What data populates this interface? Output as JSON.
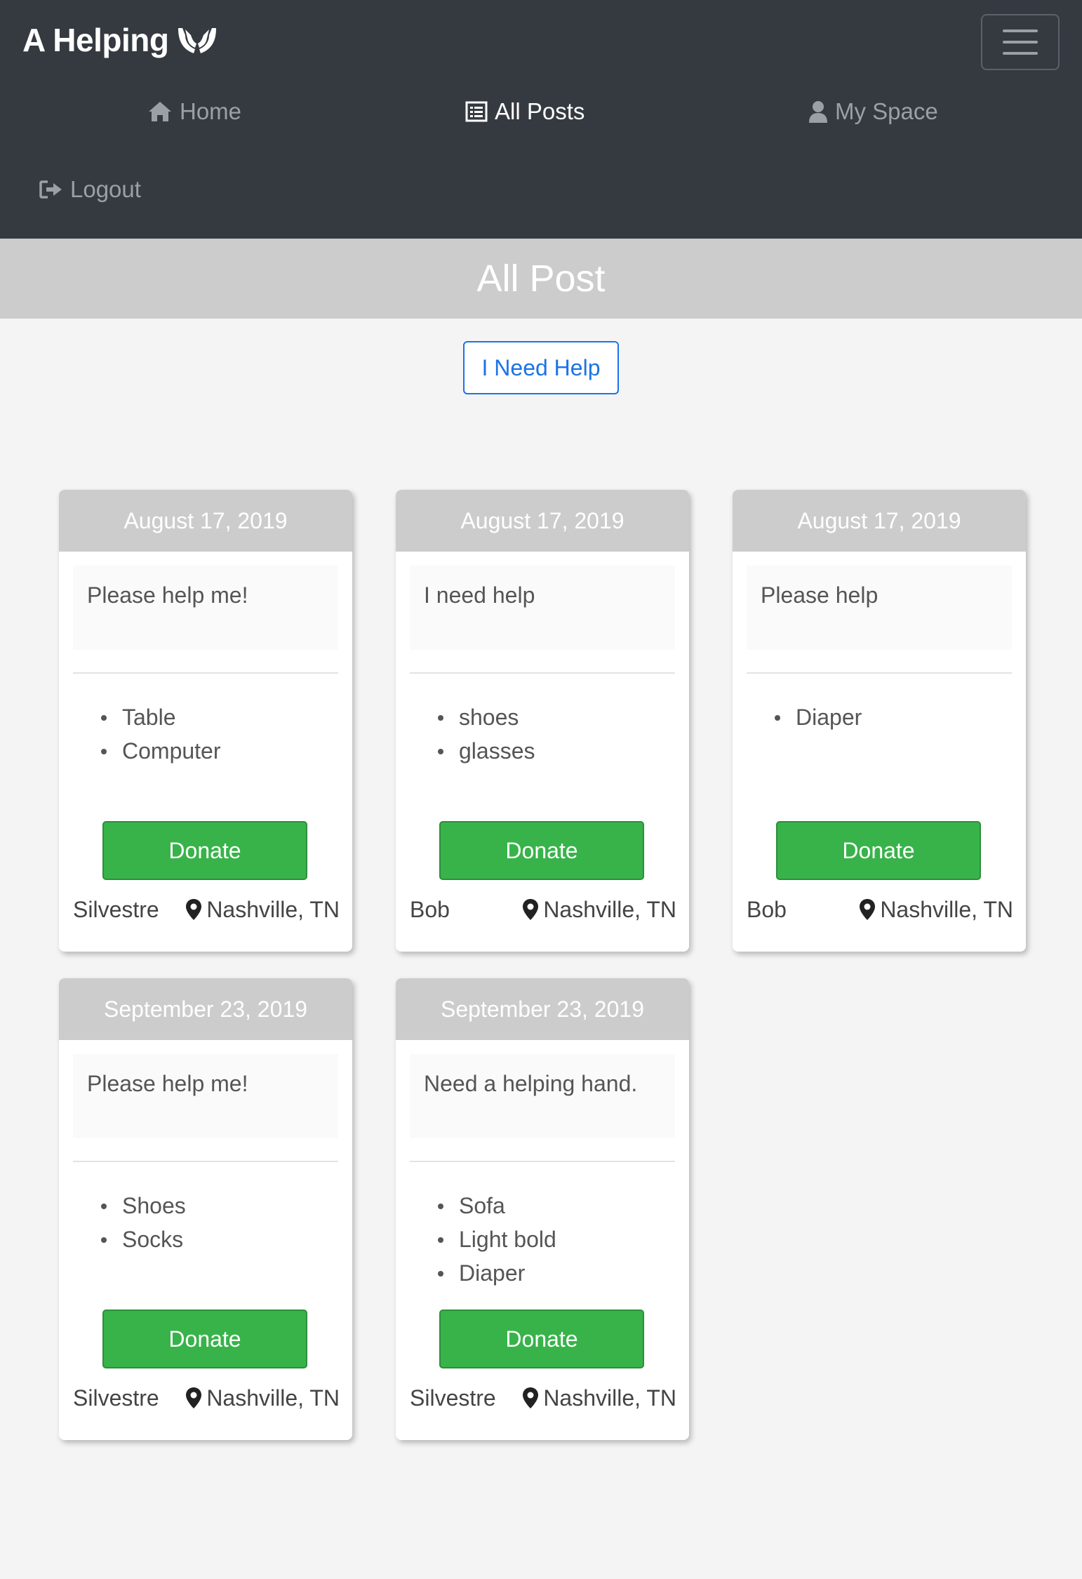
{
  "brand": {
    "title": "A Helping"
  },
  "nav": {
    "home": "Home",
    "all_posts": "All Posts",
    "my_space": "My Space",
    "logout": "Logout"
  },
  "page": {
    "title": "All Post",
    "need_help_label": "I Need Help"
  },
  "posts": [
    {
      "date": "August 17, 2019",
      "message": "Please help me!",
      "items": [
        "Table",
        "Computer"
      ],
      "donate_label": "Donate",
      "author": "Silvestre",
      "location": "Nashville, TN"
    },
    {
      "date": "August 17, 2019",
      "message": "I need help",
      "items": [
        "shoes",
        "glasses"
      ],
      "donate_label": "Donate",
      "author": "Bob",
      "location": "Nashville, TN"
    },
    {
      "date": "August 17, 2019",
      "message": "Please help",
      "items": [
        "Diaper"
      ],
      "donate_label": "Donate",
      "author": "Bob",
      "location": "Nashville, TN"
    },
    {
      "date": "September 23, 2019",
      "message": "Please help me!",
      "items": [
        "Shoes",
        "Socks"
      ],
      "donate_label": "Donate",
      "author": "Silvestre",
      "location": "Nashville, TN"
    },
    {
      "date": "September 23, 2019",
      "message": "Need a helping hand.",
      "items": [
        "Sofa",
        "Light bold",
        "Diaper"
      ],
      "donate_label": "Donate",
      "author": "Silvestre",
      "location": "Nashville, TN"
    }
  ],
  "colors": {
    "navbar": "#343a40",
    "band": "#cccccc",
    "primary": "#1a73e8",
    "donate": "#38b34a"
  },
  "icons": [
    "hands-icon",
    "menu-icon",
    "home-icon",
    "list-icon",
    "user-icon",
    "logout-icon",
    "map-pin-icon"
  ]
}
